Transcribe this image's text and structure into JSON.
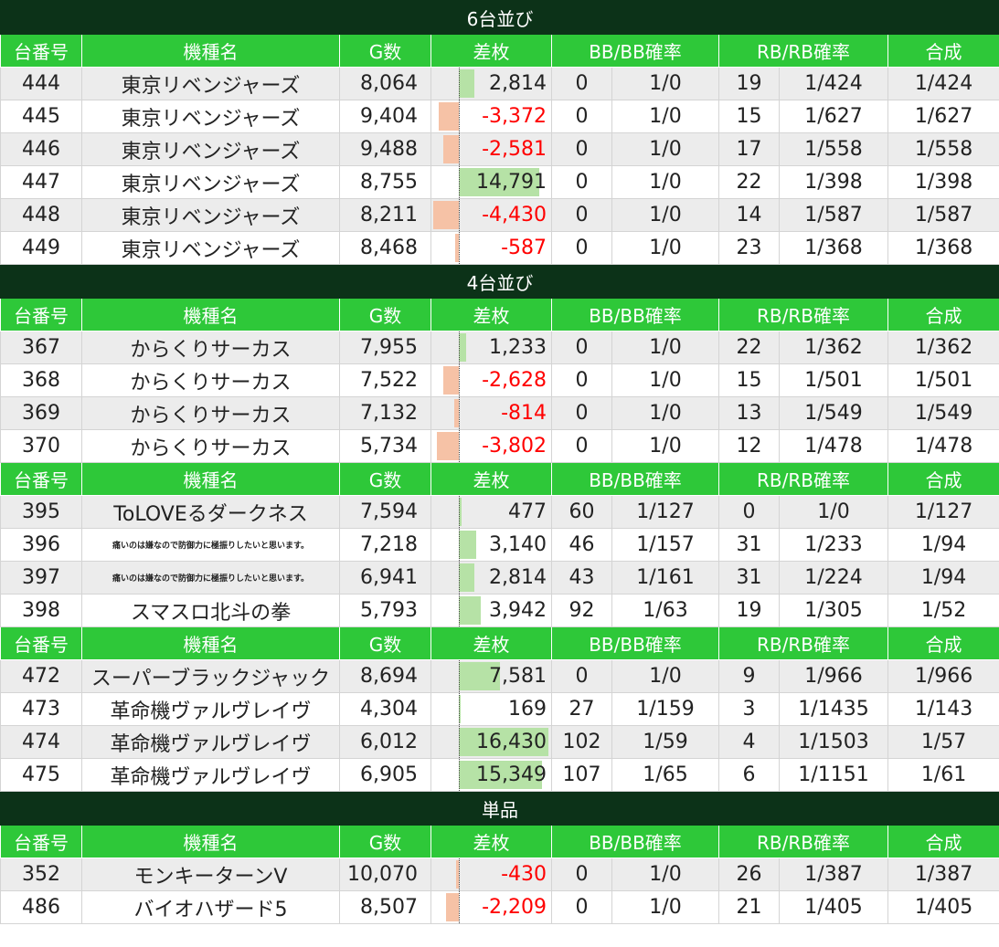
{
  "header": {
    "machine_no": "台番号",
    "machine_name": "機種名",
    "games": "G数",
    "diff": "差枚",
    "bb": "BB/BB確率",
    "rb": "RB/RB確率",
    "combined": "合成"
  },
  "colors": {
    "section_bg": "#0c3218",
    "header_bg": "#2ec839",
    "positive_bar": "#b6e2a6",
    "negative_bar": "#f6c2a6",
    "negative_text": "#ff0000"
  },
  "sections": [
    {
      "title": "6台並び",
      "groups": [
        {
          "rows": [
            {
              "no": "444",
              "name": "東京リベンジャーズ",
              "g": "8,064",
              "diff": "2,814",
              "bb": "0",
              "bbp": "1/0",
              "rb": "19",
              "rbp": "1/424",
              "comb": "1/424",
              "level": 0.17
            },
            {
              "no": "445",
              "name": "東京リベンジャーズ",
              "g": "9,404",
              "diff": "-3,372",
              "bb": "0",
              "bbp": "1/0",
              "rb": "15",
              "rbp": "1/627",
              "comb": "1/627",
              "level": -0.21
            },
            {
              "no": "446",
              "name": "東京リベンジャーズ",
              "g": "9,488",
              "diff": "-2,581",
              "bb": "0",
              "bbp": "1/0",
              "rb": "17",
              "rbp": "1/558",
              "comb": "1/558",
              "level": -0.16
            },
            {
              "no": "447",
              "name": "東京リベンジャーズ",
              "g": "8,755",
              "diff": "14,791",
              "bb": "0",
              "bbp": "1/0",
              "rb": "22",
              "rbp": "1/398",
              "comb": "1/398",
              "level": 0.9
            },
            {
              "no": "448",
              "name": "東京リベンジャーズ",
              "g": "8,211",
              "diff": "-4,430",
              "bb": "0",
              "bbp": "1/0",
              "rb": "14",
              "rbp": "1/587",
              "comb": "1/587",
              "level": -0.27
            },
            {
              "no": "449",
              "name": "東京リベンジャーズ",
              "g": "8,468",
              "diff": "-587",
              "bb": "0",
              "bbp": "1/0",
              "rb": "23",
              "rbp": "1/368",
              "comb": "1/368",
              "level": -0.04
            }
          ]
        }
      ]
    },
    {
      "title": "4台並び",
      "groups": [
        {
          "rows": [
            {
              "no": "367",
              "name": "からくりサーカス",
              "g": "7,955",
              "diff": "1,233",
              "bb": "0",
              "bbp": "1/0",
              "rb": "22",
              "rbp": "1/362",
              "comb": "1/362",
              "level": 0.08
            },
            {
              "no": "368",
              "name": "からくりサーカス",
              "g": "7,522",
              "diff": "-2,628",
              "bb": "0",
              "bbp": "1/0",
              "rb": "15",
              "rbp": "1/501",
              "comb": "1/501",
              "level": -0.16
            },
            {
              "no": "369",
              "name": "からくりサーカス",
              "g": "7,132",
              "diff": "-814",
              "bb": "0",
              "bbp": "1/0",
              "rb": "13",
              "rbp": "1/549",
              "comb": "1/549",
              "level": -0.05
            },
            {
              "no": "370",
              "name": "からくりサーカス",
              "g": "5,734",
              "diff": "-3,802",
              "bb": "0",
              "bbp": "1/0",
              "rb": "12",
              "rbp": "1/478",
              "comb": "1/478",
              "level": -0.23
            }
          ]
        },
        {
          "rows": [
            {
              "no": "395",
              "name": "ToLOVEるダークネス",
              "g": "7,594",
              "diff": "477",
              "bb": "60",
              "bbp": "1/127",
              "rb": "0",
              "rbp": "1/0",
              "comb": "1/127",
              "level": 0.03
            },
            {
              "no": "396",
              "name": "痛いのは嫌なので防御力に極振りしたいと思います。",
              "small": true,
              "g": "7,218",
              "diff": "3,140",
              "bb": "46",
              "bbp": "1/157",
              "rb": "31",
              "rbp": "1/233",
              "comb": "1/94",
              "level": 0.19
            },
            {
              "no": "397",
              "name": "痛いのは嫌なので防御力に極振りしたいと思います。",
              "small": true,
              "g": "6,941",
              "diff": "2,814",
              "bb": "43",
              "bbp": "1/161",
              "rb": "31",
              "rbp": "1/224",
              "comb": "1/94",
              "level": 0.17
            },
            {
              "no": "398",
              "name": "スマスロ北斗の拳",
              "g": "5,793",
              "diff": "3,942",
              "bb": "92",
              "bbp": "1/63",
              "rb": "19",
              "rbp": "1/305",
              "comb": "1/52",
              "level": 0.24
            }
          ]
        },
        {
          "rows": [
            {
              "no": "472",
              "name": "スーパーブラックジャック",
              "g": "8,694",
              "diff": "7,581",
              "bb": "0",
              "bbp": "1/0",
              "rb": "9",
              "rbp": "1/966",
              "comb": "1/966",
              "level": 0.46
            },
            {
              "no": "473",
              "name": "革命機ヴァルヴレイヴ",
              "g": "4,304",
              "diff": "169",
              "bb": "27",
              "bbp": "1/159",
              "rb": "3",
              "rbp": "1/1435",
              "comb": "1/143",
              "level": 0.01
            },
            {
              "no": "474",
              "name": "革命機ヴァルヴレイヴ",
              "g": "6,012",
              "diff": "16,430",
              "bb": "102",
              "bbp": "1/59",
              "rb": "4",
              "rbp": "1/1503",
              "comb": "1/57",
              "level": 1.0
            },
            {
              "no": "475",
              "name": "革命機ヴァルヴレイヴ",
              "g": "6,905",
              "diff": "15,349",
              "bb": "107",
              "bbp": "1/65",
              "rb": "6",
              "rbp": "1/1151",
              "comb": "1/61",
              "level": 0.93
            }
          ]
        }
      ]
    },
    {
      "title": "単品",
      "groups": [
        {
          "rows": [
            {
              "no": "352",
              "name": "モンキーターンV",
              "g": "10,070",
              "diff": "-430",
              "bb": "0",
              "bbp": "1/0",
              "rb": "26",
              "rbp": "1/387",
              "comb": "1/387",
              "level": -0.03
            },
            {
              "no": "486",
              "name": "バイオハザード5",
              "g": "8,507",
              "diff": "-2,209",
              "bb": "0",
              "bbp": "1/0",
              "rb": "21",
              "rbp": "1/405",
              "comb": "1/405",
              "level": -0.13
            }
          ]
        }
      ]
    }
  ]
}
